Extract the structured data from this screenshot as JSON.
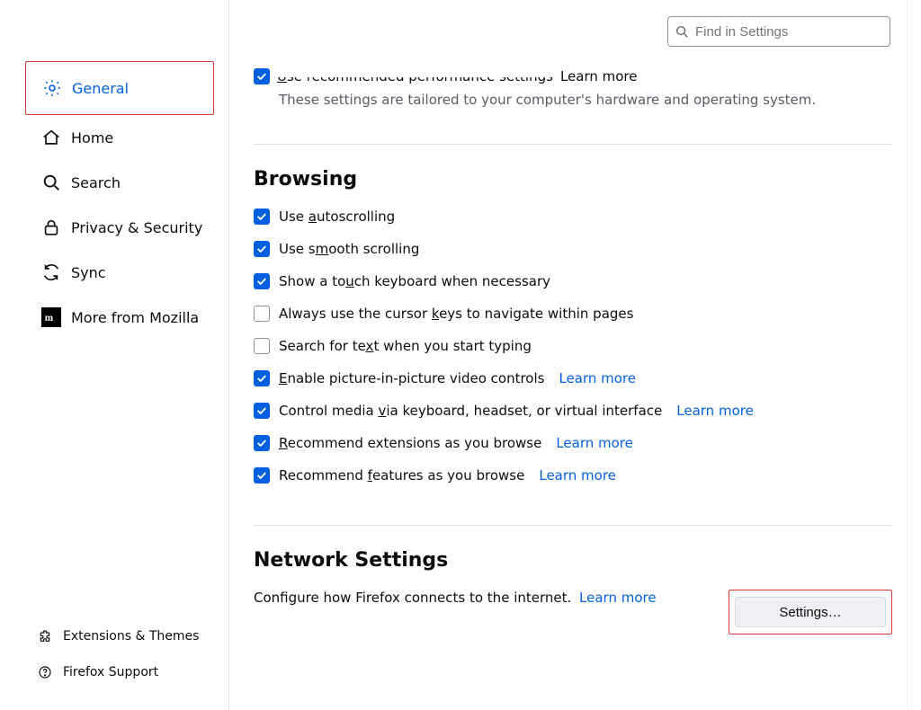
{
  "search": {
    "placeholder": "Find in Settings"
  },
  "sidebar": {
    "items": [
      {
        "label": "General"
      },
      {
        "label": "Home"
      },
      {
        "label": "Search"
      },
      {
        "label": "Privacy & Security"
      },
      {
        "label": "Sync"
      },
      {
        "label": "More from Mozilla"
      }
    ],
    "bottom": [
      {
        "label": "Extensions & Themes"
      },
      {
        "label": "Firefox Support"
      }
    ]
  },
  "performance": {
    "checkbox_label_prefix": "U",
    "checkbox_label_rest": "se recommended performance settings",
    "learn_more": "Learn more",
    "subtext": "These settings are tailored to your computer's hardware and operating system."
  },
  "browsing": {
    "heading": "Browsing",
    "items": [
      {
        "checked": true,
        "pre": "Use ",
        "m": "a",
        "post": "utoscrolling",
        "learn": ""
      },
      {
        "checked": true,
        "pre": "Use s",
        "m": "m",
        "post": "ooth scrolling",
        "learn": ""
      },
      {
        "checked": true,
        "pre": "Show a to",
        "m": "u",
        "post": "ch keyboard when necessary",
        "learn": ""
      },
      {
        "checked": false,
        "pre": "Always use the cursor ",
        "m": "k",
        "post": "eys to navigate within pages",
        "learn": ""
      },
      {
        "checked": false,
        "pre": "Search for te",
        "m": "x",
        "post": "t when you start typing",
        "learn": ""
      },
      {
        "checked": true,
        "pre": "",
        "m": "E",
        "post": "nable picture-in-picture video controls",
        "learn": "Learn more"
      },
      {
        "checked": true,
        "pre": "Control media ",
        "m": "v",
        "post": "ia keyboard, headset, or virtual interface",
        "learn": "Learn more"
      },
      {
        "checked": true,
        "pre": "",
        "m": "R",
        "post": "ecommend extensions as you browse",
        "learn": "Learn more"
      },
      {
        "checked": true,
        "pre": "Recommend ",
        "m": "f",
        "post": "eatures as you browse",
        "learn": "Learn more"
      }
    ]
  },
  "network": {
    "heading": "Network Settings",
    "desc": "Configure how Firefox connects to the internet.",
    "learn_more": "Learn more",
    "button": "Settings…"
  }
}
